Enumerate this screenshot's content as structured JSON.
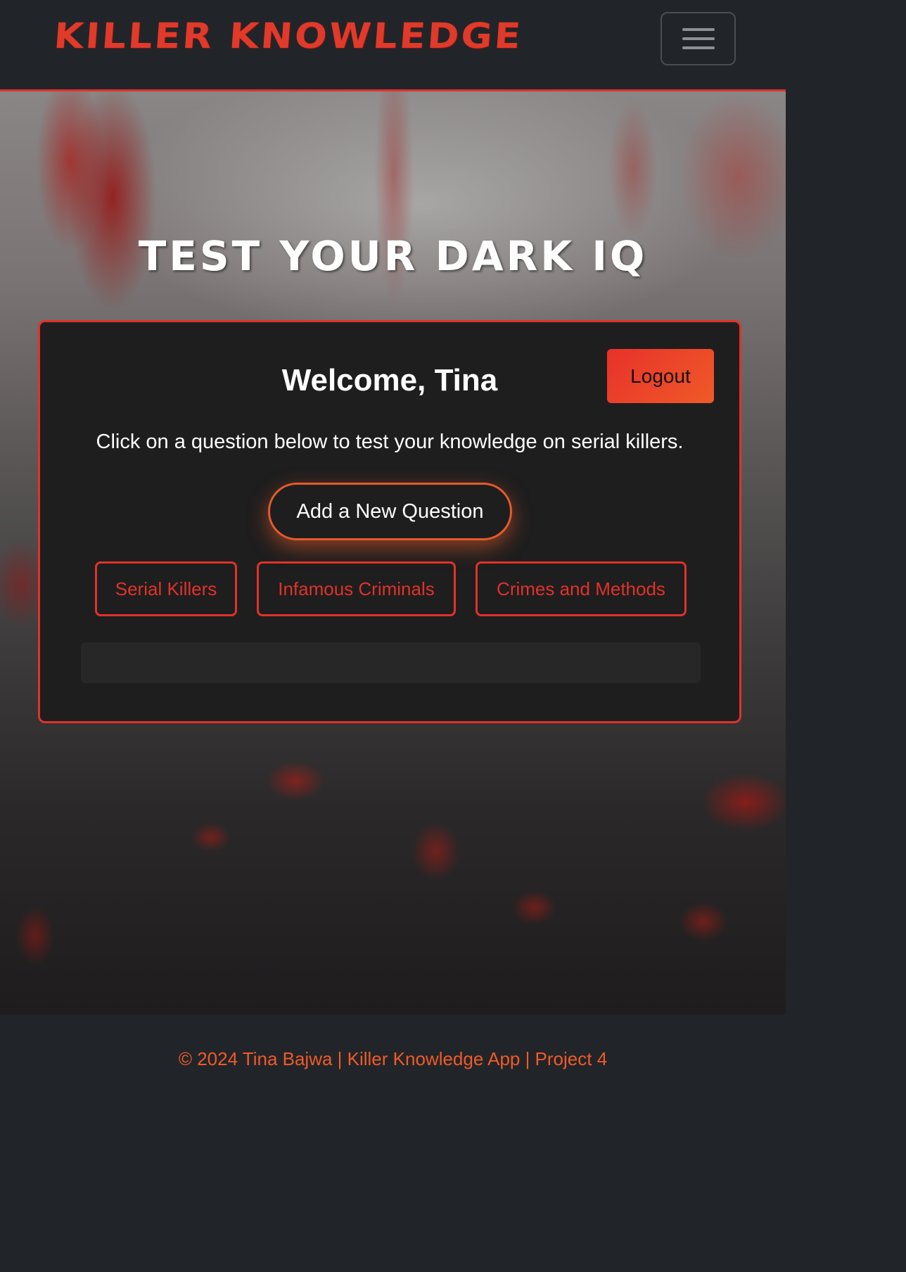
{
  "nav": {
    "brand": "KILLER KNOWLEDGE",
    "toggler_icon": "hamburger-menu-icon"
  },
  "hero": {
    "title": "TEST YOUR DARK IQ"
  },
  "card": {
    "welcome": "Welcome, Tina",
    "logout_label": "Logout",
    "intro": "Click on a question below to test your knowledge on serial killers.",
    "add_question_label": "Add a New Question",
    "categories": [
      {
        "label": "Serial Killers"
      },
      {
        "label": "Infamous Criminals"
      },
      {
        "label": "Crimes and Methods"
      }
    ]
  },
  "footer": {
    "text": "© 2024 Tina Bajwa | Killer Knowledge App | Project 4"
  },
  "colors": {
    "accent": "#e0322a",
    "accent_orange": "#f05a28",
    "nav_bg": "#212529",
    "card_bg": "#1e1e1e"
  }
}
